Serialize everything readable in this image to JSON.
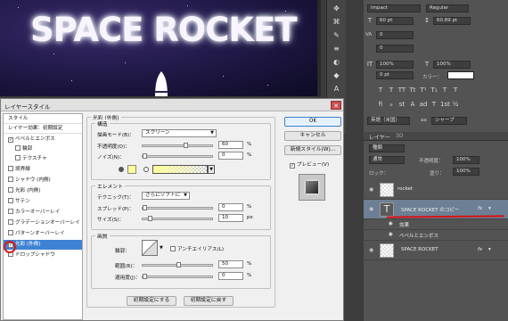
{
  "canvas": {
    "title": "SPACE ROCKET"
  },
  "character_panel": {
    "font_family": "Impact",
    "font_style": "Regular",
    "font_size": "60 pt",
    "leading": "60.89 pt",
    "kerning_label": "VA",
    "kerning_value": "0",
    "tracking_value": "0",
    "v_scale": "100%",
    "h_scale": "100%",
    "baseline": "0 pt",
    "color_label": "カラー：",
    "color_value": "#ffffff",
    "language": "英語（米国）",
    "aa_label": "aa",
    "aa_value": "シャープ"
  },
  "layers_panel": {
    "tabs": [
      "レイヤー",
      "3D"
    ],
    "filter": "種類",
    "blend": "通常",
    "opacity_label": "不透明度：",
    "opacity": "100%",
    "lock_label": "ロック：",
    "fill_label": "塗り：",
    "fill": "100%",
    "layers": [
      {
        "name": "rocket"
      },
      {
        "name": "SPACE ROCKET のコピー",
        "fx": "fx"
      },
      {
        "name": "SPACE ROCKET",
        "fx": "fx"
      }
    ],
    "effects_label": "効果",
    "effect_item": "ベベルとエンボス"
  },
  "dialog": {
    "title": "レイヤースタイル",
    "close": "✕",
    "style_list": [
      {
        "label": "スタイル",
        "header": true
      },
      {
        "label": "レイヤー効果：初期設定",
        "header": true
      },
      {
        "label": "ベベルとエンボス",
        "checked": true
      },
      {
        "label": "輪郭",
        "indent": true
      },
      {
        "label": "テクスチャ",
        "indent": true
      },
      {
        "label": "境界線"
      },
      {
        "label": "シャドウ (内側)"
      },
      {
        "label": "光彩 (内側)"
      },
      {
        "label": "サテン"
      },
      {
        "label": "カラーオーバーレイ"
      },
      {
        "label": "グラデーションオーバーレイ"
      },
      {
        "label": "パターンオーバーレイ"
      },
      {
        "label": "光彩 (外側)",
        "checked": true,
        "selected": true
      },
      {
        "label": "ドロップシャドウ"
      }
    ],
    "section_title": "光彩 (外側)",
    "structure": {
      "title": "構造",
      "blend_label": "描画モード(B)：",
      "blend_value": "スクリーン",
      "opacity_label": "不透明度(O)：",
      "opacity_value": "60",
      "noise_label": "ノイズ(N)：",
      "noise_value": "0",
      "unit": "%",
      "swatch_color": "#ffff99"
    },
    "elements": {
      "title": "エレメント",
      "technique_label": "テクニック(T)：",
      "technique_value": "さらにソフトに",
      "spread_label": "スプレッド(P)：",
      "spread_value": "0",
      "size_label": "サイズ(S)：",
      "size_value": "10",
      "pct": "%",
      "px": "px"
    },
    "quality": {
      "title": "画質",
      "contour_label": "輪郭：",
      "antialias_label": "アンチエイリアス(L)",
      "range_label": "範囲(R)：",
      "range_value": "50",
      "jitter_label": "適用度(J)：",
      "jitter_value": "0",
      "pct": "%"
    },
    "buttons": {
      "make_default": "初期設定にする",
      "reset_default": "初期設定に戻す",
      "ok": "OK",
      "cancel": "キャンセル",
      "new_style": "新規スタイル(W)...",
      "preview": "プレビュー(V)"
    }
  }
}
